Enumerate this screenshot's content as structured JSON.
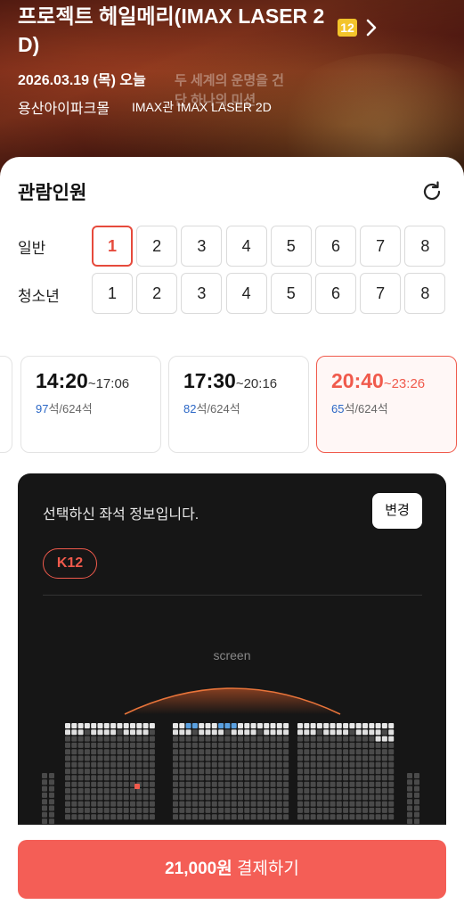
{
  "header": {
    "movie_title": "프로젝트 헤일메리(IMAX LASER 2 D)",
    "rating": "12",
    "date": "2026.03.19 (목) 오늘",
    "poster_text": "두 세계의 운명을 건 단 하나의 미션",
    "theater": "용산아이파크몰",
    "screen": "IMAX관 IMAX LASER 2D"
  },
  "audience": {
    "title": "관람인원",
    "rows": [
      {
        "label": "일반",
        "options": [
          "1",
          "2",
          "3",
          "4",
          "5",
          "6",
          "7",
          "8"
        ],
        "selected": "1"
      },
      {
        "label": "청소년",
        "options": [
          "1",
          "2",
          "3",
          "4",
          "5",
          "6",
          "7",
          "8"
        ],
        "selected": null
      }
    ]
  },
  "showtimes": [
    {
      "start": "14:20",
      "end": "~17:06",
      "available": "97",
      "total": "석/624석",
      "active": false
    },
    {
      "start": "17:30",
      "end": "~20:16",
      "available": "82",
      "total": "석/624석",
      "active": false
    },
    {
      "start": "20:40",
      "end": "~23:26",
      "available": "65",
      "total": "석/624석",
      "active": true
    }
  ],
  "seat_info": {
    "message": "선택하신 좌석 정보입니다.",
    "change_label": "변경",
    "seat": "K12",
    "screen_label": "screen"
  },
  "colors": {
    "accent": "#f05a4c",
    "pay_button": "#f45e56",
    "available_count": "#2b67c6",
    "rating_badge": "#f3c42a"
  },
  "pay": {
    "price": "21,000원",
    "label": " 결제하기"
  }
}
